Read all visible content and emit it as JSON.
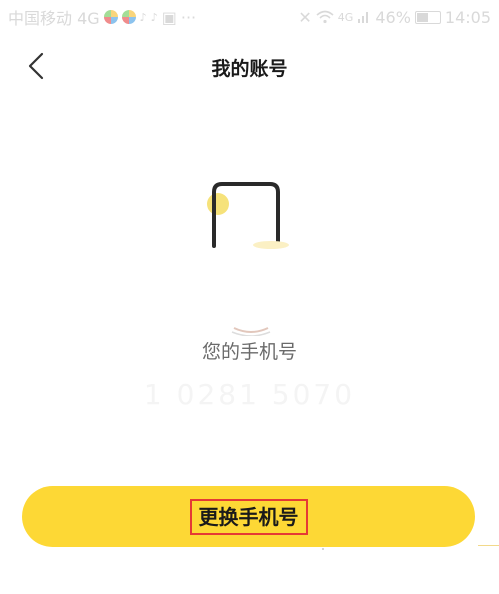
{
  "status_bar": {
    "carrier": "中国移动 4G",
    "network_small": "4G",
    "battery_percent": "46%",
    "time": "14:05",
    "icons": [
      "app-dot-icon",
      "app-dot-icon",
      "sound-icon",
      "sound-icon",
      "clipboard-icon",
      "more-icon",
      "mute-icon",
      "wifi-icon",
      "signal-icon",
      "battery-icon"
    ]
  },
  "nav": {
    "title": "我的账号",
    "back_icon": "chevron-left-icon"
  },
  "account": {
    "label": "您的手机号",
    "phone_number": "1   0281 5070"
  },
  "actions": {
    "change_phone_label": "更换手机号"
  },
  "colors": {
    "accent_yellow": "#fdd835",
    "highlight_red": "#e53935",
    "label_gray": "#6a6a6a"
  }
}
